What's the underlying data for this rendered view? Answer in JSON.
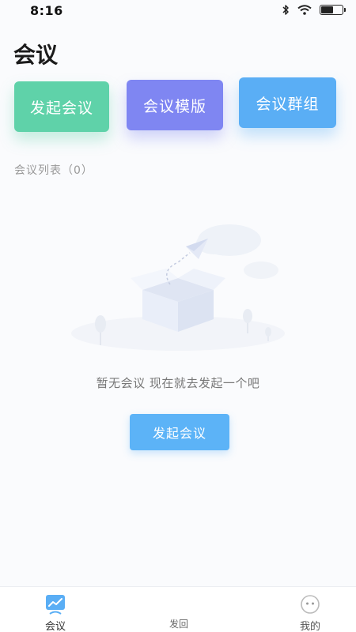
{
  "status_bar": {
    "time": "8:16"
  },
  "header": {
    "title": "会议"
  },
  "actions": {
    "start_label": "发起会议",
    "template_label": "会议模版",
    "group_label": "会议群组"
  },
  "list": {
    "header": "会议列表（0）"
  },
  "empty_state": {
    "message": "暂无会议  现在就去发起一个吧",
    "button_label": "发起会议"
  },
  "tab_bar": {
    "tabs": [
      {
        "label": "会议",
        "icon": "chart-icon",
        "active": true
      },
      {
        "label": "发回",
        "icon": ""
      },
      {
        "label": "我的",
        "icon": "face-icon"
      }
    ]
  },
  "colors": {
    "start": "#5fd2a9",
    "template": "#7f86f2",
    "group": "#5aaef5",
    "primary": "#5cb3f7"
  }
}
